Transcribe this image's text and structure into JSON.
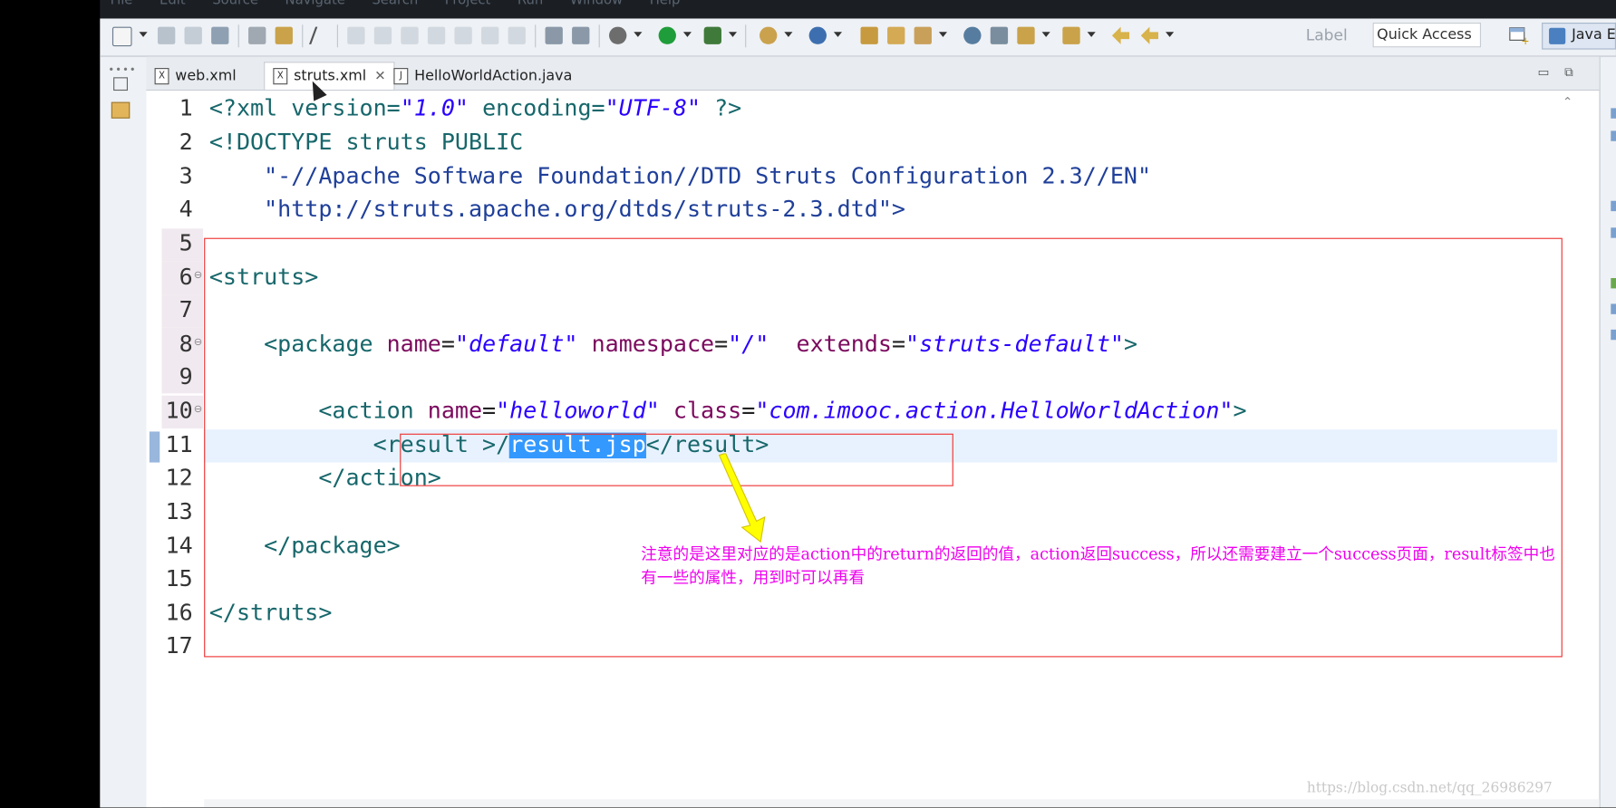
{
  "menu": [
    "File",
    "Edit",
    "Source",
    "Navigate",
    "Search",
    "Project",
    "Run",
    "Window",
    "Help"
  ],
  "toolbar": {
    "label_text": "Label",
    "quick_access": "Quick Access",
    "perspective": "Java E"
  },
  "tabs": [
    {
      "icon": "X",
      "label": "web.xml",
      "active": false
    },
    {
      "icon": "X",
      "label": "struts.xml",
      "active": true
    },
    {
      "icon": "J",
      "label": "HelloWorldAction.java",
      "active": false
    }
  ],
  "line_numbers": [
    "1",
    "2",
    "3",
    "4",
    "5",
    "6",
    "7",
    "8",
    "9",
    "10",
    "11",
    "12",
    "13",
    "14",
    "15",
    "16",
    "17"
  ],
  "code": {
    "l1_a": "<?xml version=",
    "l1_b": "\"1.0\"",
    "l1_c": " encoding=",
    "l1_d": "\"UTF-8\"",
    "l1_e": " ?>",
    "l2": "<!DOCTYPE struts PUBLIC",
    "l3": "    \"-//Apache Software Foundation//DTD Struts Configuration 2.3//EN\"",
    "l4": "    \"http://struts.apache.org/dtds/struts-2.3.dtd\">",
    "l6": "<struts>",
    "l8_a": "    <package ",
    "l8_b": "name",
    "l8_c": "=",
    "l8_d": "\"default\"",
    "l8_e": " namespace",
    "l8_f": "=",
    "l8_g": "\"/\"",
    "l8_h": "  extends",
    "l8_i": "=",
    "l8_j": "\"struts-default\"",
    "l8_k": ">",
    "l10_a": "        <action ",
    "l10_b": "name",
    "l10_c": "=",
    "l10_d": "\"helloworld\"",
    "l10_e": " class",
    "l10_f": "=",
    "l10_g": "\"com.imooc.action.HelloWorldAction\"",
    "l10_h": ">",
    "l11_a": "            <result >/",
    "l11_sel": "result.jsp",
    "l11_b": "</result>",
    "l12": "        </action>",
    "l14": "    </package>",
    "l16": "</struts>"
  },
  "annotation": "注意的是这里对应的是action中的return的返回的值，action返回success，所以还需要建立一个success页面，result标签中也有一些的属性，用到时可以再看",
  "watermark": "https://blog.csdn.net/qq_26986297",
  "colors": {
    "annotation_text": "#ee00ee",
    "annotation_box": "#ee3333",
    "arrow": "#ffff00",
    "selection": "#3399ff"
  }
}
